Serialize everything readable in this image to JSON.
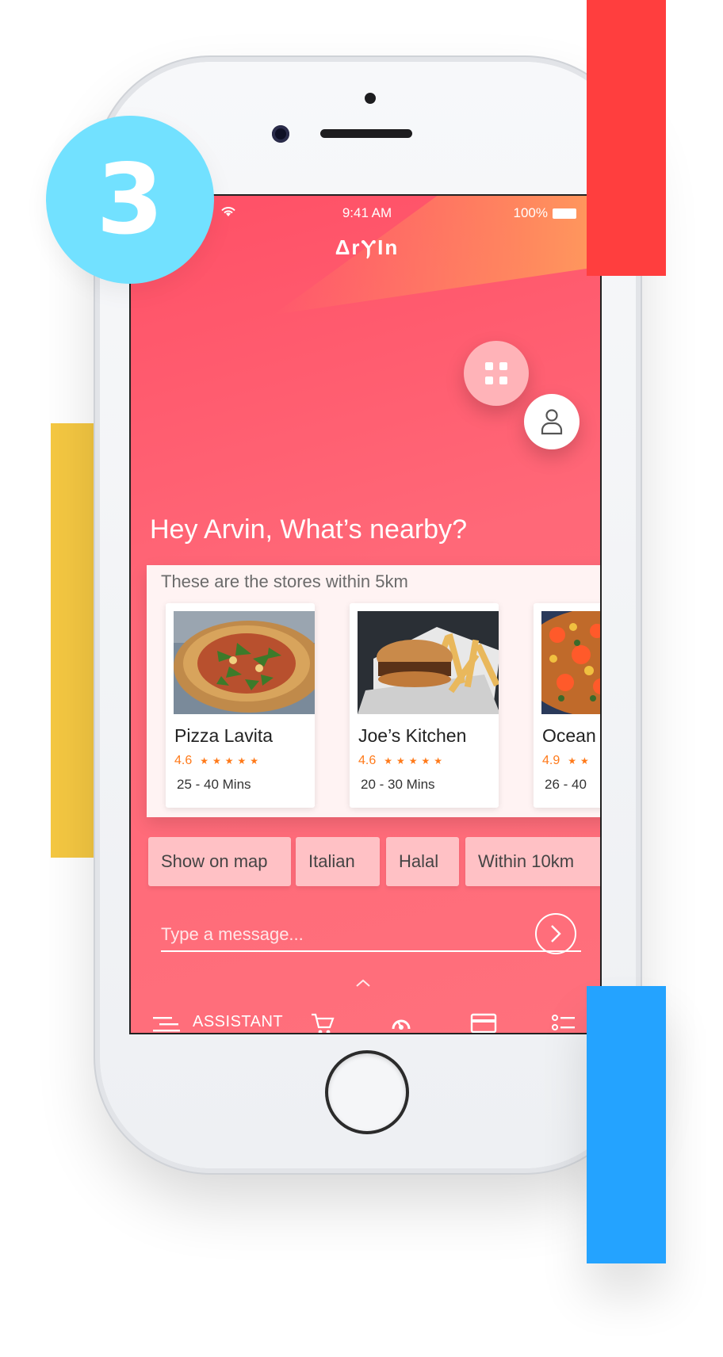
{
  "badge": {
    "number": "3",
    "color": "#72e1ff"
  },
  "colors": {
    "accent": "#ff5066",
    "deco_yellow": "#f5c842",
    "deco_red": "#ff3e3e",
    "deco_blue": "#24a3ff"
  },
  "status_bar": {
    "time": "9:41 AM",
    "battery": "100%"
  },
  "app": {
    "logo": "ΔrⲨIn"
  },
  "greeting": "Hey Arvin, What’s nearby?",
  "stores": {
    "heading": "These are the stores within 5km",
    "items": [
      {
        "name": "Pizza Lavita",
        "rating": "4.6",
        "stars": "★★★★★",
        "time": "25 - 40 Mins",
        "image": "pizza-image"
      },
      {
        "name": "Joe’s Kitchen",
        "rating": "4.6",
        "stars": "★★★★★",
        "time": "20 - 30 Mins",
        "image": "burger-fries-image"
      },
      {
        "name": "Ocean",
        "rating": "4.9",
        "stars": "★★",
        "time": "26 - 40",
        "image": "seafood-paella-image"
      }
    ]
  },
  "chips": [
    "Show on map",
    "Italian",
    "Halal",
    "Within 10km"
  ],
  "message": {
    "placeholder": "Type a message..."
  },
  "bottom_nav": {
    "assistant_label": "ASSISTANT",
    "icons": [
      "menu-icon",
      "cart-icon",
      "speedometer-icon",
      "card-icon",
      "list-icon"
    ]
  }
}
